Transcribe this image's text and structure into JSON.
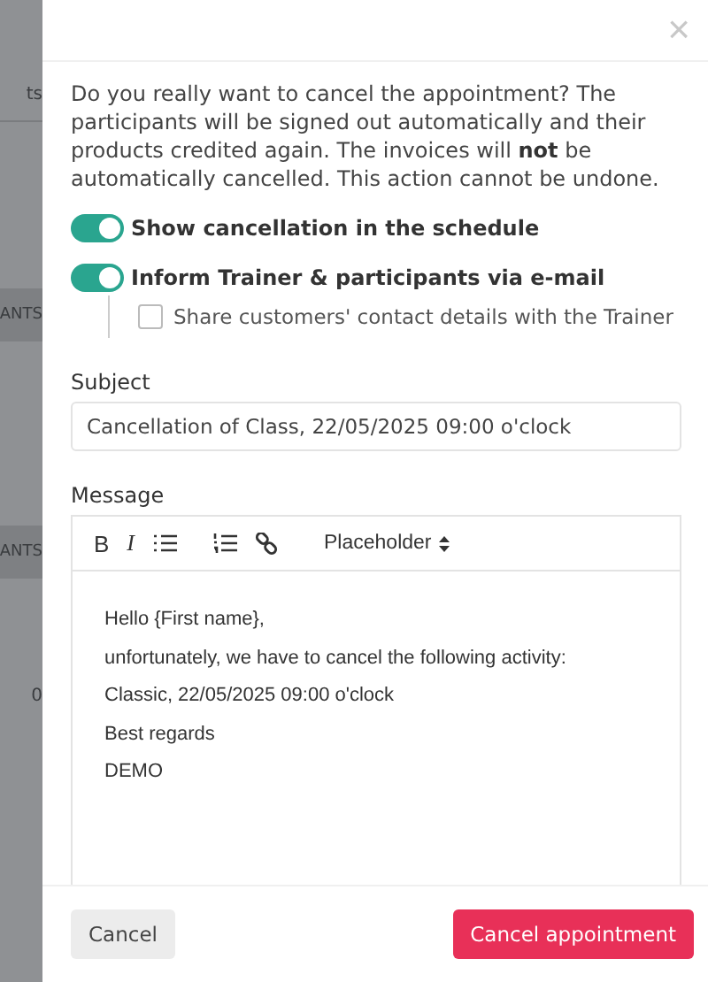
{
  "backdrop": {
    "items": [
      {
        "kind": "plain",
        "text": "ts"
      },
      {
        "kind": "band",
        "text": "ANTS"
      },
      {
        "kind": "band",
        "text": "ANTS"
      },
      {
        "kind": "plain",
        "text": "0"
      }
    ]
  },
  "dialog": {
    "close": "×",
    "intro": "Do you really want to cancel the appointment? The participants will be signed out automatically and their products credited again. The invoices will **not** be automatically cancelled. This action cannot be undone.",
    "toggles": [
      {
        "label": "Show cancellation in the schedule",
        "on": true
      },
      {
        "label": "Inform Trainer & participants via e-mail",
        "on": true
      }
    ],
    "sub_option": {
      "label": "Share customers' contact details with the Trainer",
      "checked": false
    },
    "subject": {
      "label": "Subject",
      "value": "Cancellation of Class, 22/05/2025 09:00 o'clock"
    },
    "message": {
      "label": "Message",
      "toolbar": [
        {
          "kind": "bold",
          "label": "B"
        },
        {
          "kind": "italic",
          "label": "I"
        },
        {
          "kind": "bullets"
        },
        {
          "kind": "numbered"
        },
        {
          "kind": "link"
        }
      ],
      "placeholder_menu": "Placeholder",
      "lines": [
        "Hello {First name},",
        "unfortunately, we have to cancel the following activity:",
        "Classic, 22/05/2025 09:00 o'clock",
        "Best regards",
        "DEMO"
      ]
    },
    "buttons": [
      {
        "kind": "secondary",
        "label": "Cancel"
      },
      {
        "kind": "danger",
        "label": "Cancel appointment"
      }
    ]
  }
}
